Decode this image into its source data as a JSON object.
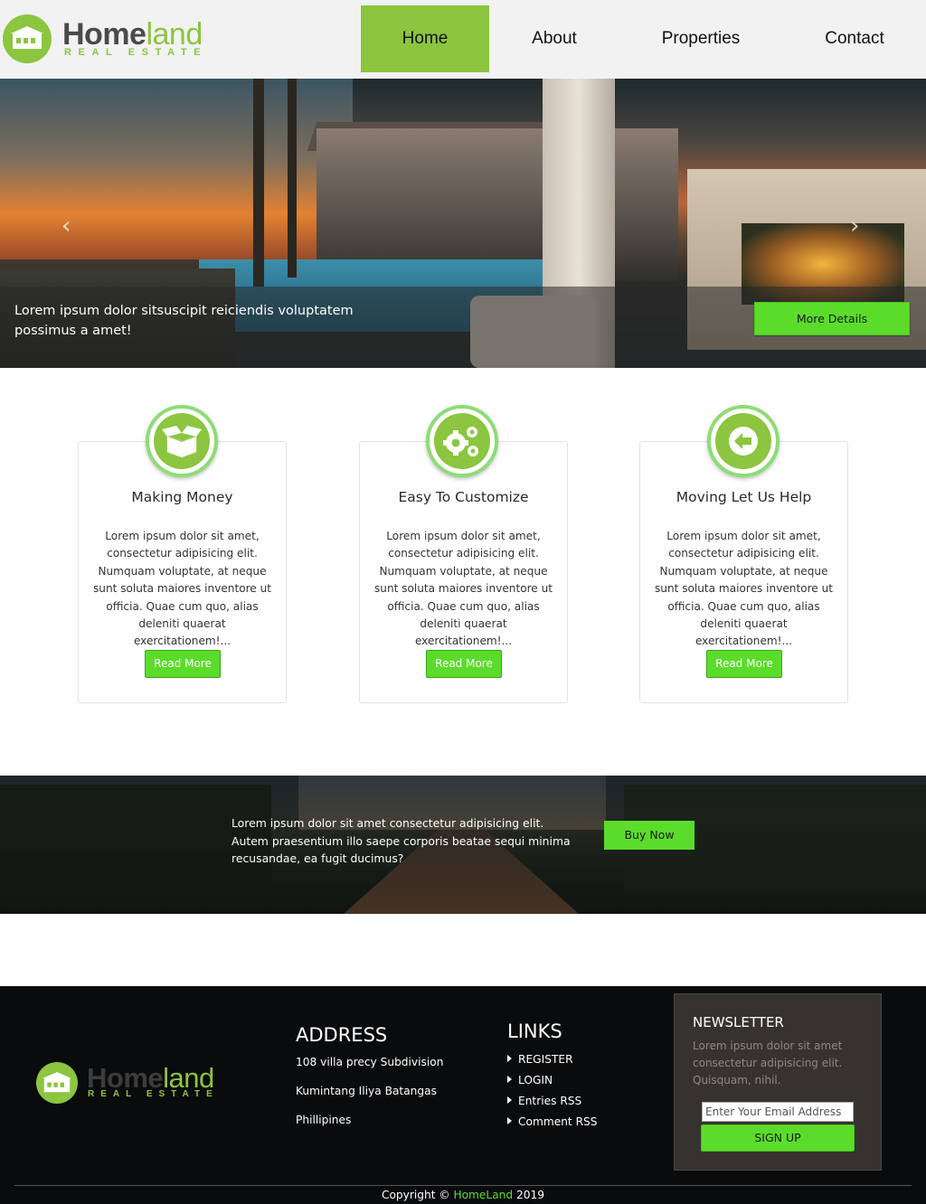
{
  "brand": {
    "name_part1": "Home",
    "name_part2": "land",
    "tagline": "REAL ESTATE",
    "accent_color": "#8cc540",
    "button_color": "#5bdc2b"
  },
  "nav": {
    "items": [
      {
        "label": "Home",
        "active": true
      },
      {
        "label": "About",
        "active": false
      },
      {
        "label": "Properties",
        "active": false
      },
      {
        "label": "Contact",
        "active": false
      }
    ]
  },
  "hero": {
    "caption": "Lorem ipsum dolor sitsuscipit reiciendis voluptatem possimus a amet!",
    "button_label": "More Details",
    "prev_icon": "chevron-left-icon",
    "next_icon": "chevron-right-icon"
  },
  "features": [
    {
      "icon": "box-icon",
      "title": "Making Money",
      "text": "Lorem ipsum dolor sit amet, consectetur adipisicing elit. Numquam voluptate, at neque sunt soluta maiores inventore ut officia. Quae cum quo, alias deleniti quaerat exercitationem!...",
      "button_label": "Read More"
    },
    {
      "icon": "gears-icon",
      "title": "Easy To Customize",
      "text": "Lorem ipsum dolor sit amet, consectetur adipisicing elit. Numquam voluptate, at neque sunt soluta maiores inventore ut officia. Quae cum quo, alias deleniti quaerat exercitationem!...",
      "button_label": "Read More"
    },
    {
      "icon": "arrow-left-circle-icon",
      "title": "Moving Let Us Help",
      "text": "Lorem ipsum dolor sit amet, consectetur adipisicing elit. Numquam voluptate, at neque sunt soluta maiores inventore ut officia. Quae cum quo, alias deleniti quaerat exercitationem!...",
      "button_label": "Read More"
    }
  ],
  "cta": {
    "text": "Lorem ipsum dolor sit amet consectetur adipisicing elit. Autem praesentium illo saepe corporis beatae sequi minima recusandae, ea fugit ducimus?",
    "button_label": "Buy Now"
  },
  "footer": {
    "address_heading": "ADDRESS",
    "address_lines": [
      "108 villa precy Subdivision",
      "Kumintang Iliya Batangas",
      "Phillipines"
    ],
    "links_heading": "LINKS",
    "links": [
      "REGISTER",
      "LOGIN",
      "Entries RSS",
      "Comment RSS"
    ],
    "newsletter": {
      "heading": "NEWSLETTER",
      "text": "Lorem ipsum dolor sit amet consectetur adipisicing elit. Quisquam, nihil.",
      "email_placeholder": "Enter Your Email Address",
      "button_label": "SIGN UP"
    },
    "copyright_prefix": "Copyright ©",
    "copyright_brand": "HomeLand",
    "copyright_year": "2019"
  }
}
